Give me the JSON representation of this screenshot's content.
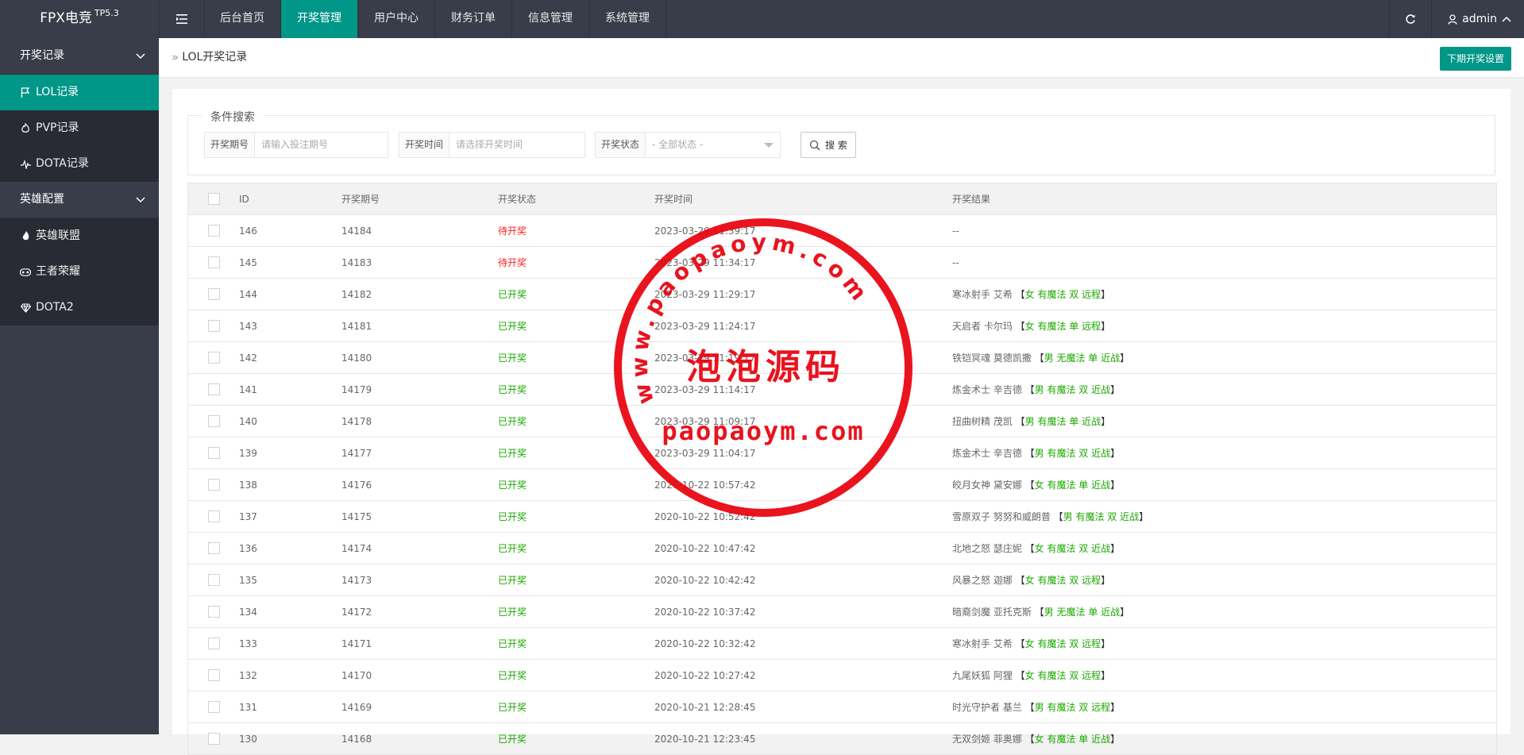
{
  "app": {
    "logo": "FPX电竞",
    "version": "TP5.3"
  },
  "top_nav": [
    {
      "label": "后台首页",
      "active": false
    },
    {
      "label": "开奖管理",
      "active": true
    },
    {
      "label": "用户中心",
      "active": false
    },
    {
      "label": "财务订单",
      "active": false
    },
    {
      "label": "信息管理",
      "active": false
    },
    {
      "label": "系统管理",
      "active": false
    }
  ],
  "user": {
    "name": "admin"
  },
  "sidebar": {
    "groups": [
      {
        "label": "开奖记录",
        "items": [
          {
            "label": "LOL记录",
            "icon": "flag-icon",
            "active": true
          },
          {
            "label": "PVP记录",
            "icon": "fire-icon",
            "active": false
          },
          {
            "label": "DOTA记录",
            "icon": "pulse-icon",
            "active": false
          }
        ]
      },
      {
        "label": "英雄配置",
        "items": [
          {
            "label": "英雄联盟",
            "icon": "flame-icon",
            "active": false
          },
          {
            "label": "王者荣耀",
            "icon": "gamepad-icon",
            "active": false
          },
          {
            "label": "DOTA2",
            "icon": "diamond-icon",
            "active": false
          }
        ]
      }
    ]
  },
  "breadcrumb": {
    "current": "LOL开奖记录"
  },
  "settings_button": "下期开奖设置",
  "search": {
    "legend": "条件搜索",
    "issue_label": "开奖期号",
    "issue_placeholder": "请输入投注期号",
    "time_label": "开奖时间",
    "time_placeholder": "请选择开奖时间",
    "status_label": "开奖状态",
    "status_value": "- 全部状态 -",
    "button": "搜 索"
  },
  "table": {
    "headers": [
      "ID",
      "开奖期号",
      "开奖状态",
      "开奖时间",
      "开奖结果"
    ],
    "rows": [
      {
        "id": "146",
        "issue": "14184",
        "status": "待开奖",
        "pending": true,
        "time": "2023-03-29 11:39:17",
        "hero": "--",
        "tag": ""
      },
      {
        "id": "145",
        "issue": "14183",
        "status": "待开奖",
        "pending": true,
        "time": "2023-03-29 11:34:17",
        "hero": "--",
        "tag": ""
      },
      {
        "id": "144",
        "issue": "14182",
        "status": "已开奖",
        "pending": false,
        "time": "2023-03-29 11:29:17",
        "hero": "寒冰射手 艾希",
        "tag": "女 有魔法 双 远程"
      },
      {
        "id": "143",
        "issue": "14181",
        "status": "已开奖",
        "pending": false,
        "time": "2023-03-29 11:24:17",
        "hero": "天启者 卡尔玛",
        "tag": "女 有魔法 单 远程"
      },
      {
        "id": "142",
        "issue": "14180",
        "status": "已开奖",
        "pending": false,
        "time": "2023-03-29 11:19:17",
        "hero": "铁铠冥魂 莫德凯撒",
        "tag": "男 无魔法 单 近战"
      },
      {
        "id": "141",
        "issue": "14179",
        "status": "已开奖",
        "pending": false,
        "time": "2023-03-29 11:14:17",
        "hero": "炼金术士 辛吉德",
        "tag": "男 有魔法 双 近战"
      },
      {
        "id": "140",
        "issue": "14178",
        "status": "已开奖",
        "pending": false,
        "time": "2023-03-29 11:09:17",
        "hero": "扭曲树精 茂凯",
        "tag": "男 有魔法 单 近战"
      },
      {
        "id": "139",
        "issue": "14177",
        "status": "已开奖",
        "pending": false,
        "time": "2023-03-29 11:04:17",
        "hero": "炼金术士 辛吉德",
        "tag": "男 有魔法 双 近战"
      },
      {
        "id": "138",
        "issue": "14176",
        "status": "已开奖",
        "pending": false,
        "time": "2020-10-22 10:57:42",
        "hero": "皎月女神 黛安娜",
        "tag": "女 有魔法 单 近战"
      },
      {
        "id": "137",
        "issue": "14175",
        "status": "已开奖",
        "pending": false,
        "time": "2020-10-22 10:52:42",
        "hero": "雪原双子 努努和威朗普",
        "tag": "男 有魔法 双 近战"
      },
      {
        "id": "136",
        "issue": "14174",
        "status": "已开奖",
        "pending": false,
        "time": "2020-10-22 10:47:42",
        "hero": "北地之怒 瑟庄妮",
        "tag": "女 有魔法 双 近战"
      },
      {
        "id": "135",
        "issue": "14173",
        "status": "已开奖",
        "pending": false,
        "time": "2020-10-22 10:42:42",
        "hero": "风暴之怒 迦娜",
        "tag": "女 有魔法 双 远程"
      },
      {
        "id": "134",
        "issue": "14172",
        "status": "已开奖",
        "pending": false,
        "time": "2020-10-22 10:37:42",
        "hero": "暗裔剑魔 亚托克斯",
        "tag": "男 无魔法 单 近战"
      },
      {
        "id": "133",
        "issue": "14171",
        "status": "已开奖",
        "pending": false,
        "time": "2020-10-22 10:32:42",
        "hero": "寒冰射手 艾希",
        "tag": "女 有魔法 双 远程"
      },
      {
        "id": "132",
        "issue": "14170",
        "status": "已开奖",
        "pending": false,
        "time": "2020-10-22 10:27:42",
        "hero": "九尾妖狐 阿狸",
        "tag": "女 有魔法 双 远程"
      },
      {
        "id": "131",
        "issue": "14169",
        "status": "已开奖",
        "pending": false,
        "time": "2020-10-21 12:28:45",
        "hero": "时光守护者 基兰",
        "tag": "男 有魔法 双 远程"
      },
      {
        "id": "130",
        "issue": "14168",
        "status": "已开奖",
        "pending": false,
        "time": "2020-10-21 12:23:45",
        "hero": "无双剑姬 菲奥娜",
        "tag": "女 有魔法 单 近战"
      }
    ]
  },
  "watermark": {
    "url": "www.paopaoym.com",
    "name": "泡泡源码",
    "domain": "paopaoym.com"
  },
  "colors": {
    "accent": "#009688",
    "header": "#393d49",
    "pending": "#ff1e1e",
    "done": "#1ba800",
    "seal": "#e8000b"
  }
}
